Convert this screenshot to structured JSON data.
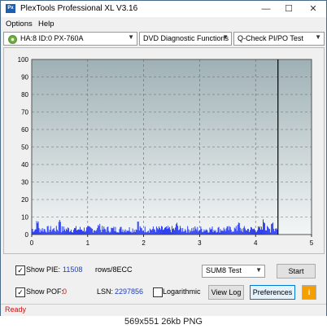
{
  "window": {
    "icon_text": "Px",
    "title": "PlexTools Professional XL V3.16",
    "minimize": "—",
    "maximize": "☐",
    "close": "✕"
  },
  "menu": [
    "Options",
    "Help"
  ],
  "toolbar": {
    "drive": "HA:8 ID:0  PX-760A",
    "function": "DVD Diagnostic Functions",
    "test": "Q-Check PI/PO Test"
  },
  "chart_data": {
    "type": "bar",
    "x_ticks": [
      "0",
      "1",
      "2",
      "3",
      "4",
      "5"
    ],
    "y_ticks": [
      "0",
      "10",
      "20",
      "30",
      "40",
      "50",
      "60",
      "70",
      "80",
      "90",
      "100"
    ],
    "xlim": [
      0,
      5
    ],
    "ylim": [
      0,
      100
    ],
    "end_marker_x": 4.4,
    "grid": true,
    "plot_bg_top": "#9fb1b5",
    "plot_bg_bottom": "#f3f6f6",
    "bar_color": "#1a2ef0",
    "marker_color": "#000000",
    "series": [
      {
        "description_only": true,
        "x_range": [
          0,
          4.4
        ],
        "typical_values": [
          1,
          2,
          3,
          4,
          5,
          6
        ],
        "peaks": [
          [
            0.1,
            8
          ],
          [
            0.5,
            9
          ],
          [
            1.2,
            7
          ],
          [
            1.9,
            8
          ],
          [
            2.6,
            7
          ],
          [
            3.7,
            7
          ],
          [
            4.15,
            9
          ],
          [
            4.3,
            8
          ]
        ]
      }
    ]
  },
  "controls": {
    "show_pie_label": "Show PIE:",
    "show_pie_checked": "✓",
    "pie_value": "11508",
    "pie_unit": "rows/8ECC",
    "show_pof_label": "Show POF:",
    "show_pof_checked": "✓",
    "pof_value": "0",
    "lsn_label": "LSN:",
    "lsn_value": "2297856",
    "logarithmic_label": "Logarithmic",
    "sum_select": "SUM8 Test",
    "start_button": "Start",
    "view_log_button": "View Log",
    "preferences_button": "Preferences",
    "info_button": "i"
  },
  "status": "Ready",
  "caption": "569x551  26kb  PNG"
}
